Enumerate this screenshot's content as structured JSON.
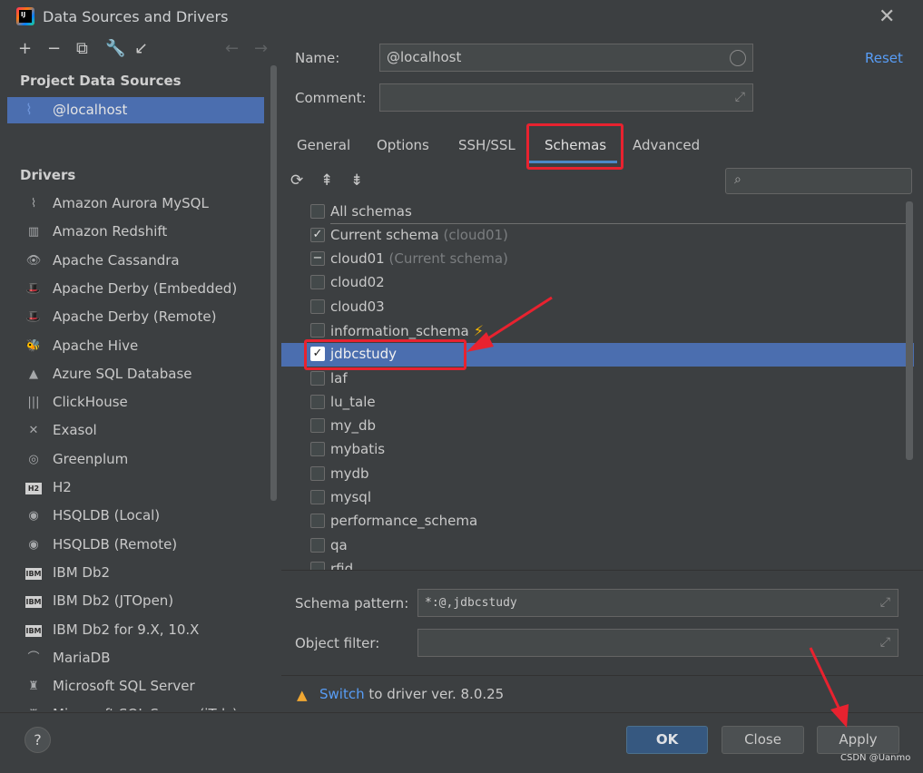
{
  "window": {
    "title": "Data Sources and Drivers",
    "app_badge": "IJ"
  },
  "sidebar": {
    "project_header": "Project Data Sources",
    "selected_source": "@localhost",
    "drivers_header": "Drivers",
    "drivers": [
      {
        "label": "Amazon Aurora MySQL",
        "icon": "⌇"
      },
      {
        "label": "Amazon Redshift",
        "icon": "▥"
      },
      {
        "label": "Apache Cassandra",
        "icon": "👁"
      },
      {
        "label": "Apache Derby (Embedded)",
        "icon": "🎩"
      },
      {
        "label": "Apache Derby (Remote)",
        "icon": "🎩"
      },
      {
        "label": "Apache Hive",
        "icon": "🐝"
      },
      {
        "label": "Azure SQL Database",
        "icon": "▲"
      },
      {
        "label": "ClickHouse",
        "icon": "|||"
      },
      {
        "label": "Exasol",
        "icon": "✕"
      },
      {
        "label": "Greenplum",
        "icon": "◎"
      },
      {
        "label": "H2",
        "icon": "H2"
      },
      {
        "label": "HSQLDB (Local)",
        "icon": "◉"
      },
      {
        "label": "HSQLDB (Remote)",
        "icon": "◉"
      },
      {
        "label": "IBM Db2",
        "icon": "IBM"
      },
      {
        "label": "IBM Db2 (JTOpen)",
        "icon": "IBM"
      },
      {
        "label": "IBM Db2 for 9.X, 10.X",
        "icon": "IBM"
      },
      {
        "label": "MariaDB",
        "icon": "⌒"
      },
      {
        "label": "Microsoft SQL Server",
        "icon": "♜"
      },
      {
        "label": "Microsoft SQL Server (jTds)",
        "icon": "♜"
      }
    ]
  },
  "form": {
    "name_label": "Name:",
    "name_value": "@localhost",
    "comment_label": "Comment:",
    "comment_value": "",
    "reset_label": "Reset"
  },
  "tabs": [
    "General",
    "Options",
    "SSH/SSL",
    "Schemas",
    "Advanced"
  ],
  "active_tab": "Schemas",
  "schemas": {
    "all_label": "All schemas",
    "current_label": "Current schema",
    "current_hint": "(cloud01)",
    "items": [
      {
        "name": "cloud01",
        "hint": "(Current schema)",
        "state": "partial"
      },
      {
        "name": "cloud02",
        "hint": "",
        "state": "unchecked"
      },
      {
        "name": "cloud03",
        "hint": "",
        "state": "unchecked"
      },
      {
        "name": "information_schema",
        "hint": "",
        "state": "unchecked"
      },
      {
        "name": "jdbcstudy",
        "hint": "",
        "state": "checked"
      },
      {
        "name": "laf",
        "hint": "",
        "state": "unchecked"
      },
      {
        "name": "lu_tale",
        "hint": "",
        "state": "unchecked"
      },
      {
        "name": "my_db",
        "hint": "",
        "state": "unchecked"
      },
      {
        "name": "mybatis",
        "hint": "",
        "state": "unchecked"
      },
      {
        "name": "mydb",
        "hint": "",
        "state": "unchecked"
      },
      {
        "name": "mysql",
        "hint": "",
        "state": "unchecked"
      },
      {
        "name": "performance_schema",
        "hint": "",
        "state": "unchecked"
      },
      {
        "name": "qa",
        "hint": "",
        "state": "unchecked"
      },
      {
        "name": "rfid",
        "hint": "",
        "state": "unchecked"
      }
    ]
  },
  "filters": {
    "schema_pattern_label": "Schema pattern:",
    "schema_pattern_value": "*:@,jdbcstudy",
    "object_filter_label": "Object filter:",
    "object_filter_value": ""
  },
  "notice": {
    "link": "Switch",
    "text": " to driver ver. 8.0.25"
  },
  "buttons": {
    "ok": "OK",
    "close": "Close",
    "apply": "Apply",
    "help": "?"
  },
  "watermark": "CSDN @Uanmo",
  "colors": {
    "selection": "#4b6eaf",
    "annotation_red": "#e8222f",
    "link": "#589df6"
  }
}
